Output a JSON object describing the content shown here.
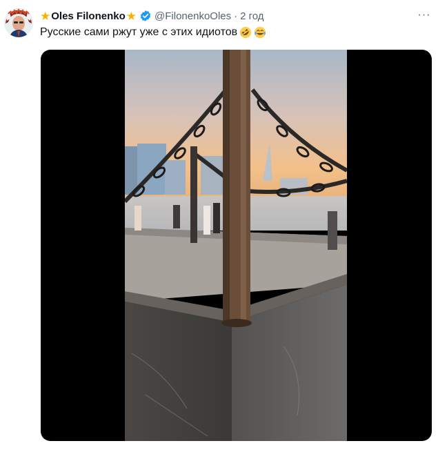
{
  "tweet": {
    "display_name": "Oles Filonenko",
    "handle": "@FilonenkoOles",
    "separator": "·",
    "time": "2 год",
    "text": "Русские сами ржут уже с этих идиотов",
    "emojis": [
      "rolling-on-floor-laughing",
      "tears-of-joy"
    ],
    "more_label": "···"
  },
  "colors": {
    "verified": "#1d9bf0",
    "star": "#f5b400",
    "secondary_text": "#536471",
    "media_background": "#000000"
  },
  "icons": {
    "name_badges": [
      "star-icon",
      "star-icon"
    ],
    "verified": "verified-badge-icon",
    "more": "more-options-icon"
  }
}
